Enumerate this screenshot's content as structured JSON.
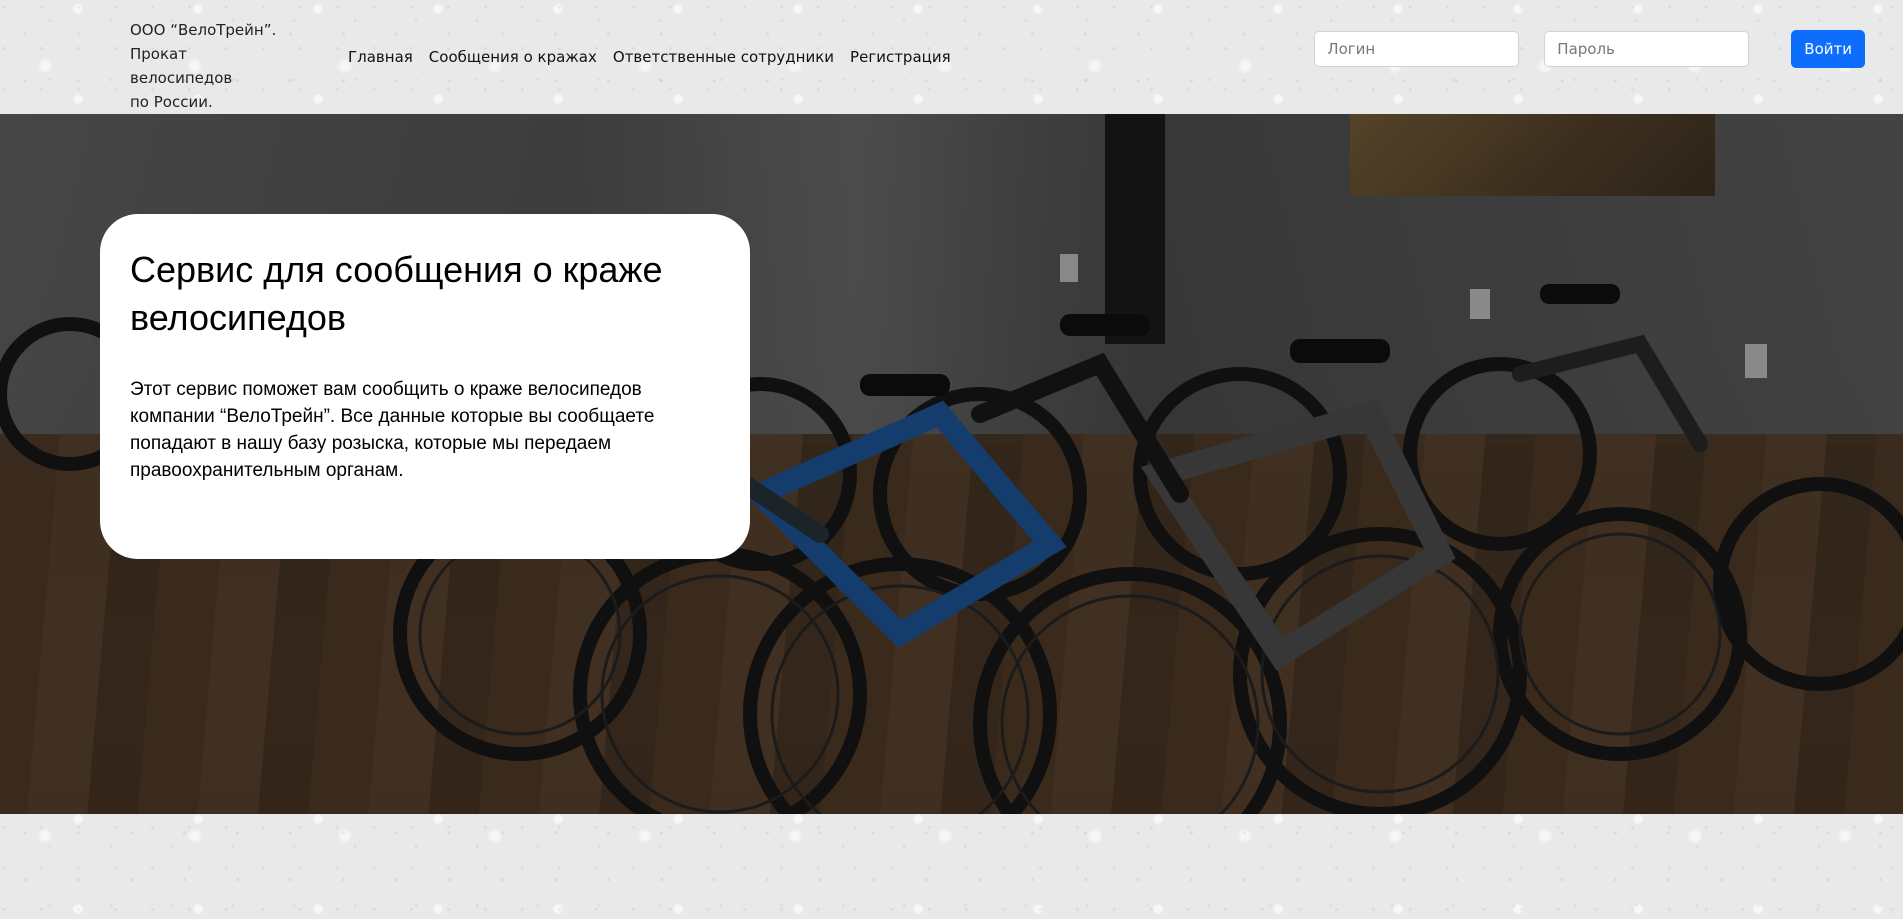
{
  "header": {
    "brand_lines": [
      "ООО “ВелоТрейн”.",
      "Прокат велосипедов",
      "по России."
    ],
    "nav": [
      {
        "label": "Главная"
      },
      {
        "label": "Сообщения о кражах"
      },
      {
        "label": "Ответственные сотрудники"
      },
      {
        "label": "Регистрация"
      }
    ],
    "login": {
      "username_placeholder": "Логин",
      "password_placeholder": "Пароль",
      "submit_label": "Войти"
    }
  },
  "hero": {
    "title": "Сервис для сообщения о краже велосипедов",
    "text": "Этот сервис поможет вам сообщить о краже велосипедов компании “ВелоТрейн”. Все данные которые вы сообщаете попадают в нашу базу розыска, которые мы передаем правоохранительным органам."
  },
  "colors": {
    "accent": "#0d6efd",
    "card_background": "#ffffff"
  },
  "icons": {
    "hero_image": "bicycles-showroom-photo"
  }
}
